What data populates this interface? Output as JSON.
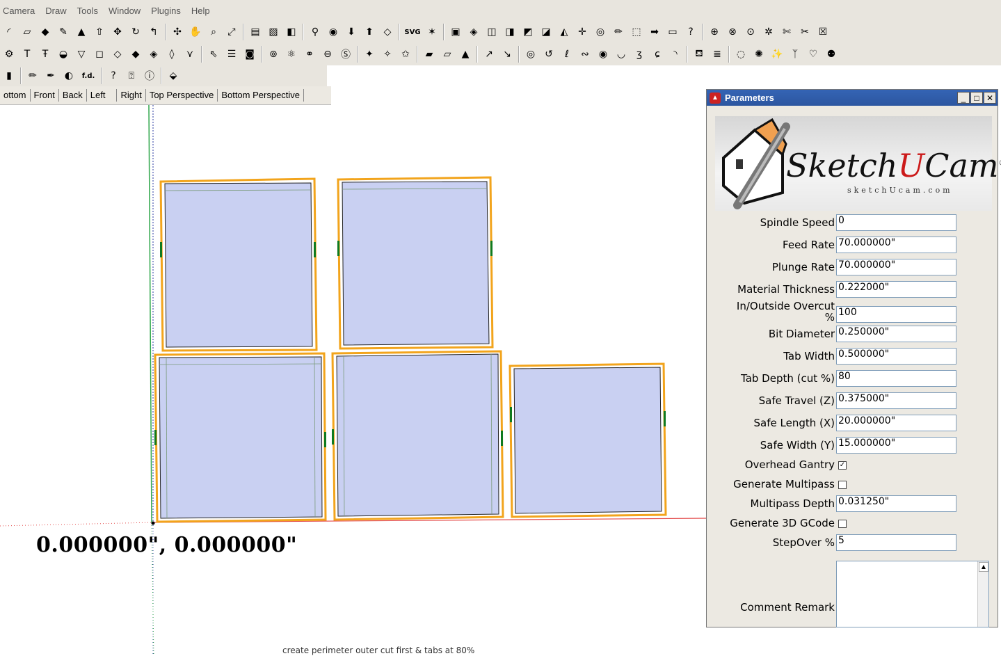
{
  "menu": [
    "Camera",
    "Draw",
    "Tools",
    "Window",
    "Plugins",
    "Help"
  ],
  "toolbar_icons_row1": [
    {
      "name": "arc-icon",
      "glyph": "◜"
    },
    {
      "name": "eraser-icon",
      "glyph": "▱"
    },
    {
      "name": "eraser-pink-icon",
      "glyph": "◆"
    },
    {
      "name": "tape-icon",
      "glyph": "✎"
    },
    {
      "name": "paint-icon",
      "glyph": "▲"
    },
    {
      "name": "push-pull-icon",
      "glyph": "⇧"
    },
    {
      "name": "move-icon",
      "glyph": "✥"
    },
    {
      "name": "rotate-icon",
      "glyph": "↻"
    },
    {
      "name": "follow-me-icon",
      "glyph": "↰"
    },
    {
      "name": "orbit-icon",
      "glyph": "✣"
    },
    {
      "name": "pan-icon",
      "glyph": "✋"
    },
    {
      "name": "zoom-icon",
      "glyph": "⌕"
    },
    {
      "name": "zoom-extents-icon",
      "glyph": "⤢"
    },
    {
      "name": "section-icon",
      "glyph": "▤"
    },
    {
      "name": "layer-icon",
      "glyph": "▧"
    },
    {
      "name": "component-icon",
      "glyph": "◧"
    },
    {
      "name": "walk-icon",
      "glyph": "⚲"
    },
    {
      "name": "look-icon",
      "glyph": "◉"
    },
    {
      "name": "warehouse-icon",
      "glyph": "⬇"
    },
    {
      "name": "share-icon",
      "glyph": "⬆"
    },
    {
      "name": "extension-icon",
      "glyph": "◇"
    },
    {
      "name": "svg-icon",
      "glyph": "SVG"
    },
    {
      "name": "plugin-x-icon",
      "glyph": "✶"
    },
    {
      "name": "box-view-icon",
      "glyph": "▣"
    },
    {
      "name": "iso-icon",
      "glyph": "◈"
    },
    {
      "name": "top-view-icon",
      "glyph": "◫"
    },
    {
      "name": "front-view-icon",
      "glyph": "◨"
    },
    {
      "name": "right-view-icon",
      "glyph": "◩"
    },
    {
      "name": "back-view-icon",
      "glyph": "◪"
    },
    {
      "name": "left-view-icon",
      "glyph": "◭"
    },
    {
      "name": "axes-icon",
      "glyph": "✛"
    },
    {
      "name": "fog-icon",
      "glyph": "◎"
    },
    {
      "name": "pencil-icon",
      "glyph": "✏"
    },
    {
      "name": "cursor-icon",
      "glyph": "⬚"
    },
    {
      "name": "arrow-right-icon",
      "glyph": "➡"
    },
    {
      "name": "screen-icon",
      "glyph": "▭"
    },
    {
      "name": "help-icon",
      "glyph": "?"
    },
    {
      "name": "target-icon",
      "glyph": "⊕"
    },
    {
      "name": "target2-icon",
      "glyph": "⊗"
    },
    {
      "name": "target3-icon",
      "glyph": "⊙"
    },
    {
      "name": "gear-icon",
      "glyph": "✲"
    },
    {
      "name": "cut-icon",
      "glyph": "✄"
    },
    {
      "name": "cut2-icon",
      "glyph": "✂"
    },
    {
      "name": "close-red-icon",
      "glyph": "☒"
    }
  ],
  "toolbar_icons_row2": [
    {
      "name": "gcode-gear-icon",
      "glyph": "⚙"
    },
    {
      "name": "tcut-icon",
      "glyph": "T"
    },
    {
      "name": "tcut2-icon",
      "glyph": "Ŧ"
    },
    {
      "name": "pocket-icon",
      "glyph": "◒"
    },
    {
      "name": "drill-icon",
      "glyph": "▽"
    },
    {
      "name": "profile-icon",
      "glyph": "◻"
    },
    {
      "name": "inside-icon",
      "glyph": "◇"
    },
    {
      "name": "outside-icon",
      "glyph": "◆"
    },
    {
      "name": "offset-icon",
      "glyph": "◈"
    },
    {
      "name": "chamfer-icon",
      "glyph": "◊"
    },
    {
      "name": "vcarve-icon",
      "glyph": "⋎"
    },
    {
      "name": "select-icon",
      "glyph": "⇖"
    },
    {
      "name": "list-icon",
      "glyph": "☰"
    },
    {
      "name": "toggle-icon",
      "glyph": "◙"
    },
    {
      "name": "tab-icon",
      "glyph": "⊚"
    },
    {
      "name": "spindle-icon",
      "glyph": "⚛"
    },
    {
      "name": "multi-icon",
      "glyph": "⚭"
    },
    {
      "name": "eraser-cam-icon",
      "glyph": "⊖"
    },
    {
      "name": "svg-import-icon",
      "glyph": "Ⓢ"
    },
    {
      "name": "star1-icon",
      "glyph": "✦"
    },
    {
      "name": "star2-icon",
      "glyph": "✧"
    },
    {
      "name": "star3-icon",
      "glyph": "✩"
    },
    {
      "name": "plot1-icon",
      "glyph": "▰"
    },
    {
      "name": "plot2-icon",
      "glyph": "▱"
    },
    {
      "name": "plot3-icon",
      "glyph": "▲"
    },
    {
      "name": "arrow1-icon",
      "glyph": "↗"
    },
    {
      "name": "arrow2-icon",
      "glyph": "↘"
    },
    {
      "name": "spiral1-icon",
      "glyph": "◎"
    },
    {
      "name": "spiral2-icon",
      "glyph": "↺"
    },
    {
      "name": "spiral3-icon",
      "glyph": "ℓ"
    },
    {
      "name": "spiral4-icon",
      "glyph": "∾"
    },
    {
      "name": "spiral5-icon",
      "glyph": "◉"
    },
    {
      "name": "spiral6-icon",
      "glyph": "◡"
    },
    {
      "name": "spiral7-icon",
      "glyph": "ʒ"
    },
    {
      "name": "spiral8-icon",
      "glyph": "ɕ"
    },
    {
      "name": "spiral9-icon",
      "glyph": "◝"
    },
    {
      "name": "paint-bucket-icon",
      "glyph": "⛾"
    },
    {
      "name": "stack-icon",
      "glyph": "≣"
    },
    {
      "name": "circle-dots-icon",
      "glyph": "◌"
    },
    {
      "name": "burst-icon",
      "glyph": "✺"
    },
    {
      "name": "spark-icon",
      "glyph": "✨"
    },
    {
      "name": "figure-icon",
      "glyph": "ᛉ"
    },
    {
      "name": "heart-icon",
      "glyph": "♡"
    },
    {
      "name": "medal-icon",
      "glyph": "⚉"
    }
  ],
  "toolbar_icons_row3": [
    {
      "name": "paint-small-icon",
      "glyph": "▮"
    },
    {
      "name": "pencil-small-icon",
      "glyph": "✏"
    },
    {
      "name": "dropper-icon",
      "glyph": "✒"
    },
    {
      "name": "contrast-icon",
      "glyph": "◐"
    },
    {
      "name": "fd-icon",
      "glyph": "f.d."
    },
    {
      "name": "help-circle-icon",
      "glyph": "?"
    },
    {
      "name": "help-user-icon",
      "glyph": "⍰"
    },
    {
      "name": "info-icon",
      "glyph": "ⓘ"
    },
    {
      "name": "bucket-icon",
      "glyph": "⬙"
    }
  ],
  "view_tabs": [
    "ottom",
    "Front",
    "Back",
    "Left",
    "Right",
    "Top Perspective",
    "Bottom Perspective"
  ],
  "coords": "0.000000\", 0.000000\"",
  "status": "create perimeter outer cut first & tabs at 80%",
  "colors": {
    "panel_fill": "#c9d0f2",
    "cut_outline": "#f2a41c",
    "tab_marker": "#0f7a1f",
    "axis_red": "#e34a4a",
    "axis_green": "#2ea64a",
    "axis_blue": "#2a3aa0"
  },
  "window": {
    "title": "Parameters",
    "minimize": "_",
    "maximize": "□",
    "close": "✕"
  },
  "logo": {
    "text_a": "Sketch",
    "text_u": "U",
    "text_b": "Cam",
    "reg": "®",
    "subtitle": "sketchUcam.com"
  },
  "params": [
    {
      "label": "Spindle Speed",
      "value": "0",
      "kind": "input"
    },
    {
      "label": "Feed Rate",
      "value": "70.000000\"",
      "kind": "input"
    },
    {
      "label": "Plunge Rate",
      "value": "70.000000\"",
      "kind": "input"
    },
    {
      "label": "Material Thickness",
      "value": "0.222000\"",
      "kind": "input"
    },
    {
      "label": "In/Outside Overcut",
      "label2": "%",
      "value": "100",
      "kind": "input2"
    },
    {
      "label": "Bit Diameter",
      "value": "0.250000\"",
      "kind": "input"
    },
    {
      "label": "Tab Width",
      "value": "0.500000\"",
      "kind": "input"
    },
    {
      "label": "Tab Depth (cut %)",
      "value": "80",
      "kind": "input"
    },
    {
      "label": "Safe Travel (Z)",
      "value": "0.375000\"",
      "kind": "input"
    },
    {
      "label": "Safe Length (X)",
      "value": "20.000000\"",
      "kind": "input"
    },
    {
      "label": "Safe Width (Y)",
      "value": "15.000000\"",
      "kind": "input"
    },
    {
      "label": "Overhead Gantry",
      "checked": true,
      "kind": "check"
    },
    {
      "label": "Generate Multipass",
      "checked": false,
      "kind": "check"
    },
    {
      "label": "Multipass Depth",
      "value": "0.031250\"",
      "kind": "input"
    },
    {
      "label": "Generate 3D GCode",
      "checked": false,
      "kind": "check"
    },
    {
      "label": "StepOver %",
      "value": "5",
      "kind": "input"
    },
    {
      "label": "Comment Remark",
      "value": "",
      "kind": "textarea"
    }
  ]
}
